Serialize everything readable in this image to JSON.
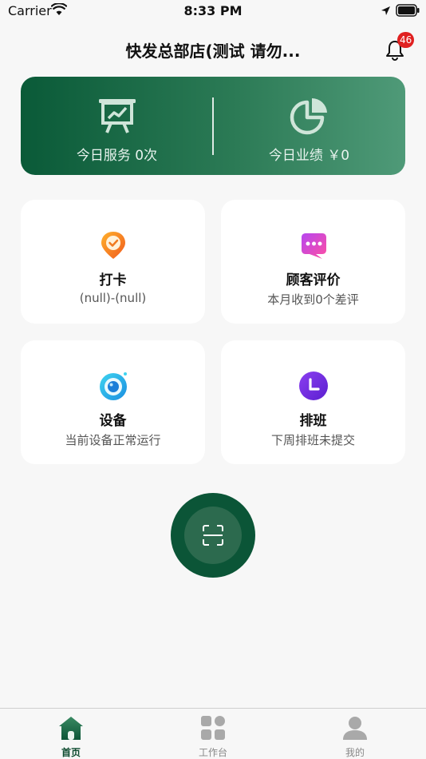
{
  "status_bar": {
    "carrier": "Carrier",
    "time": "8:33 PM"
  },
  "header": {
    "title": "快发总部店(测试 请勿...",
    "notification_count": "46"
  },
  "stats": {
    "service_label": "今日服务 0次",
    "performance_label": "今日业绩 ￥0"
  },
  "cards": [
    {
      "title": "打卡",
      "subtitle": "(null)-(null)",
      "icon": "location-check-icon"
    },
    {
      "title": "顾客评价",
      "subtitle": "本月收到0个差评",
      "icon": "chat-bubble-icon"
    },
    {
      "title": "设备",
      "subtitle": "当前设备正常运行",
      "icon": "camera-lens-icon"
    },
    {
      "title": "排班",
      "subtitle": "下周排班未提交",
      "icon": "clock-icon"
    }
  ],
  "tabs": [
    {
      "label": "首页",
      "icon": "home-icon",
      "active": true
    },
    {
      "label": "工作台",
      "icon": "grid-icon",
      "active": false
    },
    {
      "label": "我的",
      "icon": "user-icon",
      "active": false
    }
  ],
  "colors": {
    "brand_green": "#0b5537",
    "banner_gradient_start": "#0a5a38",
    "banner_gradient_end": "#4f9a78",
    "badge_red": "#e02020"
  }
}
